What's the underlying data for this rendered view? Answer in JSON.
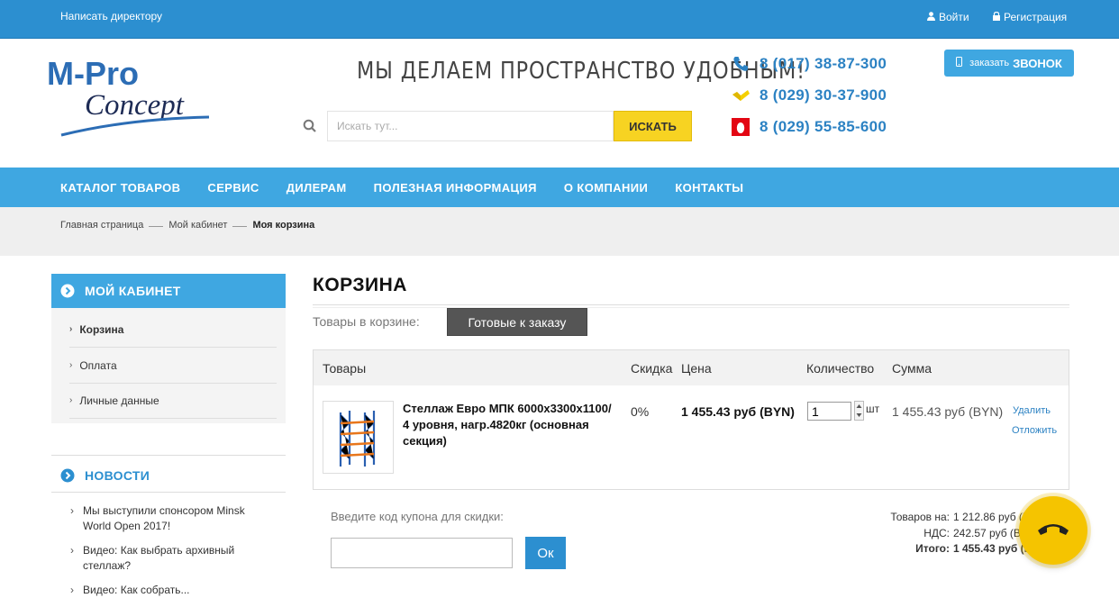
{
  "topbar": {
    "director_link": "Написать директору",
    "login": "Войти",
    "register": "Регистрация"
  },
  "header": {
    "logo_top": "M-Pro",
    "logo_bottom": "Concept",
    "slogan": "Мы делаем пространство удобным!",
    "search_placeholder": "Искать тут...",
    "search_button": "ИСКАТЬ",
    "phones": [
      "8 (017) 38-87-300",
      "8 (029) 30-37-900",
      "8 (029) 55-85-600"
    ],
    "callback_prefix": "заказать",
    "callback_main": "ЗВОНОК"
  },
  "nav": [
    "КАТАЛОГ ТОВАРОВ",
    "СЕРВИС",
    "ДИЛЕРАМ",
    "ПОЛЕЗНАЯ ИНФОРМАЦИЯ",
    "О КОМПАНИИ",
    "КОНТАКТЫ"
  ],
  "breadcrumb": [
    "Главная страница",
    "Мой кабинет",
    "Моя корзина"
  ],
  "sidebar": {
    "title": "МОЙ КАБИНЕТ",
    "items": [
      "Корзина",
      "Оплата",
      "Личные данные"
    ],
    "news_title": "НОВОСТИ",
    "news": [
      "Мы выступили спонсором Minsk World Open 2017!",
      "Видео: Как выбрать архивный стеллаж?",
      "Видео: Как собрать..."
    ]
  },
  "cart": {
    "title": "КОРЗИНА",
    "in_cart_label": "Товары в корзине:",
    "tab_ready": "Готовые к заказу",
    "headers": {
      "items": "Товары",
      "discount": "Скидка",
      "price": "Цена",
      "qty": "Количество",
      "sum": "Сумма"
    },
    "product": {
      "name": "Стеллаж Евро МПК 6000x3300x1100/ 4 уровня, нагр.4820кг (основная секция)",
      "discount": "0%",
      "price": "1 455.43 руб (BYN)",
      "qty": "1",
      "unit": "шт",
      "sum": "1 455.43 руб (BYN)",
      "delete": "Удалить",
      "later": "Отложить"
    },
    "coupon_label": "Введите код купона для скидки:",
    "coupon_button": "Ок",
    "totals": {
      "goods_label": "Товаров на:",
      "goods_value": "1 212.86 руб (BYN)",
      "vat_label": "НДС:",
      "vat_value": "242.57 руб (BYN)",
      "total_label": "Итого:",
      "total_value": "1 455.43 руб (BYN)"
    }
  },
  "colors": {
    "primary": "#3fa7e1",
    "topbar": "#2c8fd0",
    "accent_yellow": "#f7d322",
    "phone_text": "#2c82c3"
  }
}
